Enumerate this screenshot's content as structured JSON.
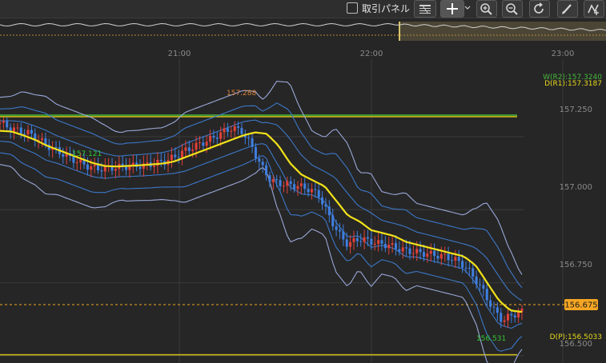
{
  "toolbar": {
    "panel_checkbox_label": "取引パネル",
    "panel_checkbox_checked": false,
    "icons": [
      "grid-settings-icon",
      "crosshair-icon",
      "zoom-in-icon",
      "zoom-out-icon",
      "refresh-icon",
      "pencil-draw-icon",
      "indicator-icon"
    ]
  },
  "colors": {
    "background": "#262626",
    "grid": "#3a3a3a",
    "up_candle": "#e0413a",
    "down_candle": "#3f7fe0",
    "ma_line": "#f2e21a",
    "band_outer": "#9aa8d8",
    "band_inner": "#3c78c8",
    "current_price": "#f5a623",
    "pivot_line": "#c8b81a",
    "w_r2_line": "#45b83a"
  },
  "chart_data": {
    "type": "candlestick",
    "x_ticks": [
      "21:00",
      "22:00",
      "23:00"
    ],
    "y_ticks": [
      "157.250",
      "157.000",
      "156.750",
      "156.500"
    ],
    "ylim": [
      156.475,
      157.565
    ],
    "series": [
      {
        "name": "close_path",
        "values": [
          157.298,
          157.28,
          157.27,
          157.262,
          157.24,
          157.218,
          157.2,
          157.182,
          157.165,
          157.15,
          157.14,
          157.142,
          157.145,
          157.148,
          157.15,
          157.152,
          157.158,
          157.165,
          157.18,
          157.2,
          157.215,
          157.23,
          157.245,
          157.265,
          157.28,
          157.27,
          157.22,
          157.15,
          157.1,
          157.09,
          157.085,
          157.08,
          157.07,
          157.05,
          156.98,
          156.92,
          156.88,
          156.9,
          156.895,
          156.885,
          156.88,
          156.87,
          156.86,
          156.855,
          156.85,
          156.845,
          156.84,
          156.83,
          156.81,
          156.77,
          156.72,
          156.66,
          156.62,
          156.64,
          156.65
        ]
      },
      {
        "name": "ma",
        "values": [
          157.27,
          157.268,
          157.255,
          157.24,
          157.22,
          157.205,
          157.19,
          157.175,
          157.16,
          157.15,
          157.148,
          157.15,
          157.152,
          157.155,
          157.158,
          157.165,
          157.18,
          157.195,
          157.21,
          157.225,
          157.24,
          157.255,
          157.265,
          157.26,
          157.22,
          157.16,
          157.12,
          157.1,
          157.08,
          157.03,
          156.98,
          156.96,
          156.93,
          156.92,
          156.91,
          156.89,
          156.88,
          156.87,
          156.86,
          156.85,
          156.84,
          156.81,
          156.75,
          156.69,
          156.655,
          156.65
        ]
      }
    ],
    "annotations": [
      {
        "text": "157.288",
        "x": "20:55",
        "y": 157.288,
        "color": "#d9803a"
      },
      {
        "text": "157.121",
        "x": "20:22",
        "y": 157.121,
        "color": "#32c832"
      },
      {
        "text": "156.531",
        "x": "22:54",
        "y": 156.531,
        "color": "#32c832"
      }
    ],
    "horizontal_lines": [
      {
        "label": "W(R2):157.3240",
        "value": 157.324
      },
      {
        "label": "D(R1):157.3187",
        "value": 157.3187
      },
      {
        "label": "D(P):156.5033",
        "value": 156.5033
      }
    ],
    "current_price": "156.675",
    "current_price_value": 156.675
  }
}
